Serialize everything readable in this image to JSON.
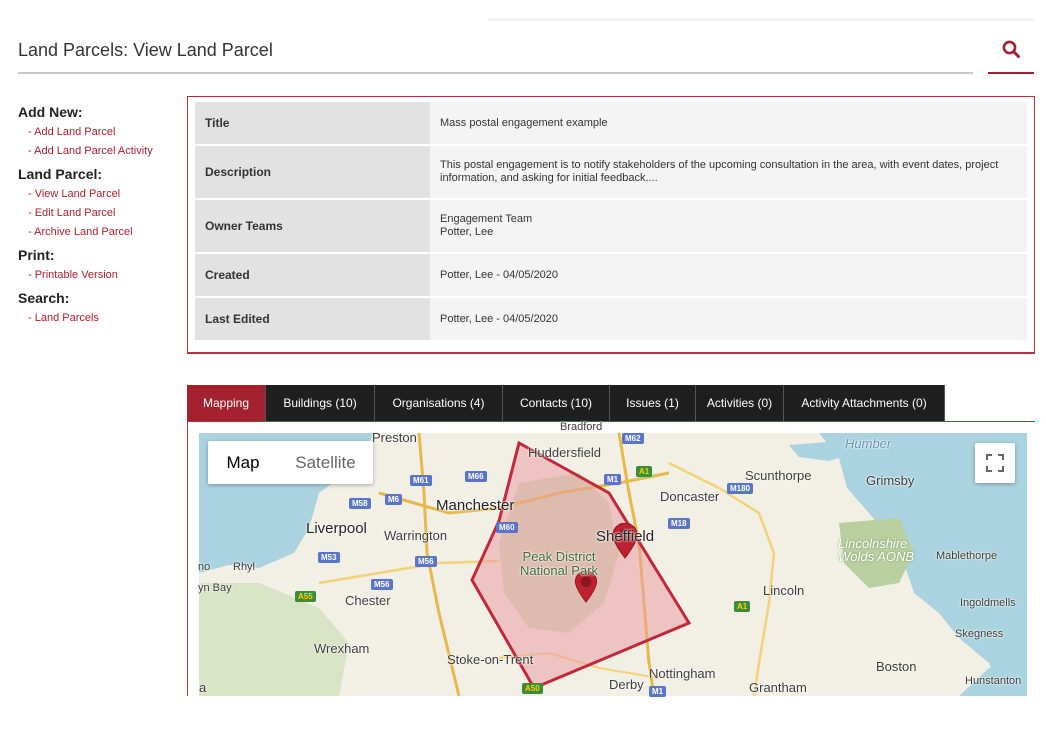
{
  "header": {
    "title": "Land Parcels: View Land Parcel"
  },
  "sidebar": {
    "groups": [
      {
        "heading": "Add New:",
        "links": [
          "- Add Land Parcel",
          "- Add Land Parcel Activity"
        ]
      },
      {
        "heading": "Land Parcel:",
        "links": [
          "- View Land Parcel",
          "- Edit Land Parcel",
          "- Archive Land Parcel"
        ]
      },
      {
        "heading": "Print:",
        "links": [
          "- Printable Version"
        ]
      },
      {
        "heading": "Search:",
        "links": [
          "- Land Parcels"
        ]
      }
    ]
  },
  "details": {
    "rows": [
      {
        "label": "Title",
        "value": "Mass postal engagement example"
      },
      {
        "label": "Description",
        "value": "This postal engagement is to notify stakeholders of the upcoming consultation in the area, with event dates, project information, and asking for initial feedback...."
      },
      {
        "label": "Owner Teams",
        "value_lines": [
          "Engagement Team",
          "Potter, Lee"
        ]
      },
      {
        "label": "Created",
        "value": "Potter, Lee - 04/05/2020"
      },
      {
        "label": "Last Edited",
        "value": "Potter, Lee - 04/05/2020"
      }
    ]
  },
  "tabs": [
    {
      "label": "Mapping",
      "active": true
    },
    {
      "label": "Buildings (10)"
    },
    {
      "label": "Organisations (4)"
    },
    {
      "label": "Contacts (10)"
    },
    {
      "label": "Issues (1)"
    },
    {
      "label": "Activities (0)"
    },
    {
      "label": "Activity Attachments (0)"
    }
  ],
  "map": {
    "type_control": {
      "map_label": "Map",
      "satellite_label": "Satellite",
      "selected": "Map"
    },
    "fullscreen_icon": "fullscreen-icon",
    "places": {
      "preston": "Preston",
      "bradford": "Bradford",
      "humber": "Humber",
      "huddersfield": "Huddersfield",
      "scunthorpe": "Scunthorpe",
      "grimsby": "Grimsby",
      "doncaster": "Doncaster",
      "manchester": "Manchester",
      "liverpool": "Liverpool",
      "warrington": "Warrington",
      "sheffield": "Sheffield",
      "peak_district": "Peak District\nNational Park",
      "lincolnshire": "Lincolnshire\nWolds AONB",
      "mablethorpe": "Mablethorpe",
      "rhyl": "Rhyl",
      "no": "no",
      "yn_bay": "yn Bay",
      "chester": "Chester",
      "lincoln": "Lincoln",
      "ingoldmells": "Ingoldmells",
      "skegness": "Skegness",
      "wrexham": "Wrexham",
      "stoke": "Stoke-on-Trent",
      "boston": "Boston",
      "derby": "Derby",
      "nottingham": "Nottingham",
      "grantham": "Grantham",
      "hunstanton": "Hunstanton",
      "a_edge": "a"
    },
    "roads": {
      "m62_top": "M62",
      "m61": "M61",
      "m66": "M66",
      "m1_top": "M1",
      "a1_top": "A1",
      "m180": "M180",
      "m58": "M58",
      "m6": "M6",
      "m60": "M60",
      "m18": "M18",
      "m53": "M53",
      "m56_a": "M56",
      "m56_b": "M56",
      "a55": "A55",
      "a1_mid": "A1",
      "a50": "A50",
      "m1_bottom": "M1",
      "m62_edge": "M62"
    },
    "colors": {
      "polygon_stroke": "#c2283b",
      "polygon_fill": "#e9a0a5",
      "marker": "#c0212f",
      "land": "#f2efe4",
      "water": "#aad3df",
      "park": "#cfdcb9"
    },
    "markers": [
      {
        "name": "marker-sheffield",
        "icon": "map-pin-icon"
      },
      {
        "name": "marker-peak",
        "icon": "map-pin-icon"
      }
    ]
  },
  "icons": {
    "search": "search-icon"
  }
}
